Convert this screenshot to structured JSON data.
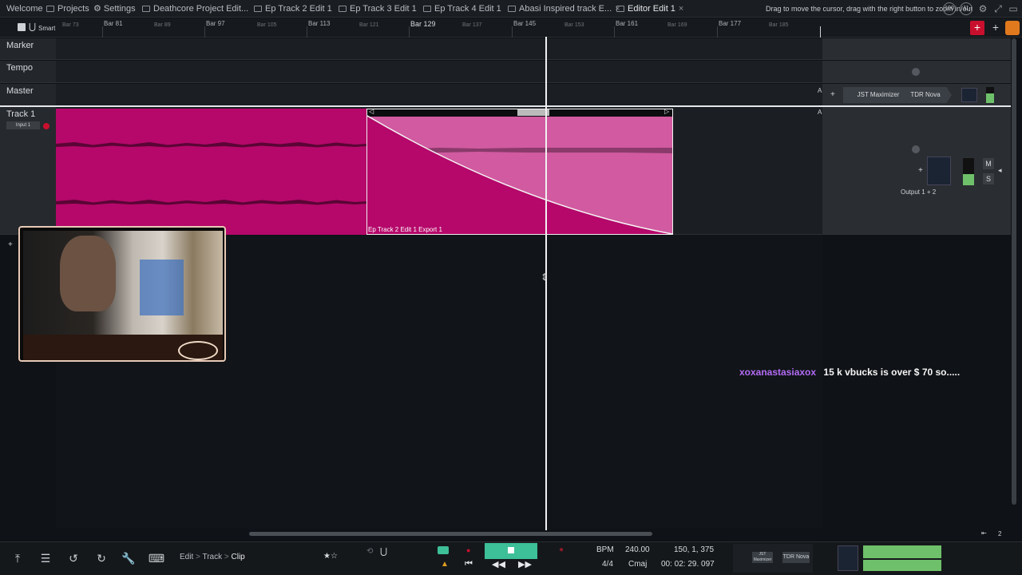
{
  "tabs": [
    {
      "label": "Welcome",
      "active": false
    },
    {
      "label": "Projects",
      "active": false
    },
    {
      "label": "Settings",
      "active": false
    },
    {
      "label": "Deathcore Project Edit...",
      "active": false
    },
    {
      "label": "Ep Track 2 Edit 1",
      "active": false
    },
    {
      "label": "Ep Track 3 Edit 1",
      "active": false
    },
    {
      "label": "Ep Track 4 Edit 1",
      "active": false
    },
    {
      "label": "Abasi Inspired track E...",
      "active": false
    },
    {
      "label": "Editor Edit 1",
      "active": true
    }
  ],
  "hint": "Drag to move the cursor, drag with the right button to zoom in/out",
  "top_icons": {
    "cpu": "100",
    "disk": "11"
  },
  "ruler": {
    "mode_label": "Smart",
    "bars_major": [
      "Bar 81",
      "Bar 97",
      "Bar 113",
      "Bar 129",
      "Bar 145",
      "Bar 161",
      "Bar 177"
    ],
    "bars_minor": [
      "Bar 73",
      "Bar 89",
      "Bar 105",
      "Bar 121",
      "Bar 137",
      "Bar 153",
      "Bar 169",
      "Bar 185"
    ]
  },
  "tracks": {
    "marker": "Marker",
    "tempo": "Tempo",
    "master": "Master",
    "track1": "Track 1",
    "track1_input": "Input 1"
  },
  "master_plugins": [
    "JST Maximizer",
    "TDR Nova"
  ],
  "track1_output": "Output 1 + 2",
  "track1_buttons": {
    "mute": "M",
    "solo": "S"
  },
  "clip": {
    "name": "Ep Track 2 Edit 1 Export 1"
  },
  "chat": {
    "user": "xoxanastasiaxox",
    "message": "15 k vbucks is over $ 70 so....."
  },
  "breadcrumb": [
    "Edit",
    "Track",
    "Clip"
  ],
  "transport": {
    "bpm_label": "BPM",
    "bpm": "240.00",
    "time_sig": "4/4",
    "key": "Cmaj",
    "position_bars": "150, 1, 375",
    "position_time": "00: 02: 29. 097"
  },
  "mini_plugins": [
    "JST Maximizer",
    "TDR Nova"
  ],
  "zoom_indicator": "2",
  "colors": {
    "clip_dark": "#b5086a",
    "clip_light": "#d15aa0",
    "meter": "#6fc06a",
    "accent_play": "#3dbf98",
    "chat_user": "#b36cf5"
  }
}
